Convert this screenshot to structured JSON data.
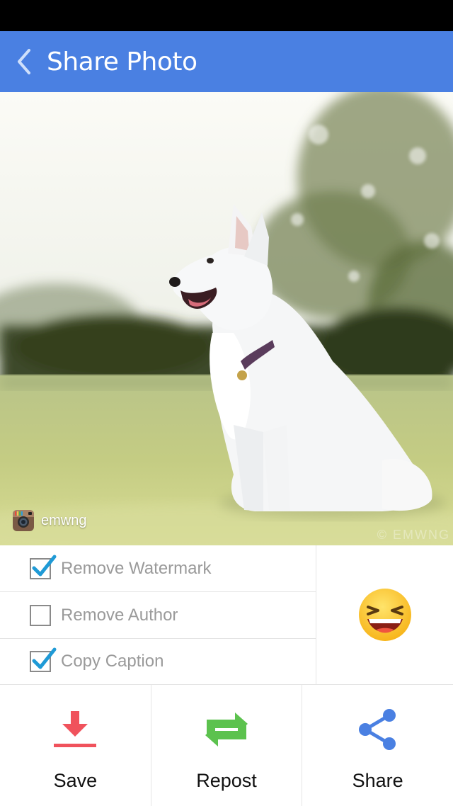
{
  "header": {
    "title": "Share Photo",
    "back_icon": "chevron-left-icon",
    "bar_color": "#4a80e2"
  },
  "photo": {
    "author": "emwng",
    "watermark": "© EMWNG",
    "source_icon": "instagram-icon"
  },
  "options": [
    {
      "label": "Remove Watermark",
      "checked": true
    },
    {
      "label": "Remove Author",
      "checked": false
    },
    {
      "label": "Copy Caption",
      "checked": true
    }
  ],
  "emoji_button": {
    "icon": "laughing-emoji-icon"
  },
  "actions": [
    {
      "label": "Save",
      "icon": "download-icon",
      "color": "#f0525c"
    },
    {
      "label": "Repost",
      "icon": "repost-icon",
      "color": "#5cc24e"
    },
    {
      "label": "Share",
      "icon": "share-icon",
      "color": "#4a80e2"
    }
  ],
  "colors": {
    "check_accent": "#1f9ad6"
  }
}
